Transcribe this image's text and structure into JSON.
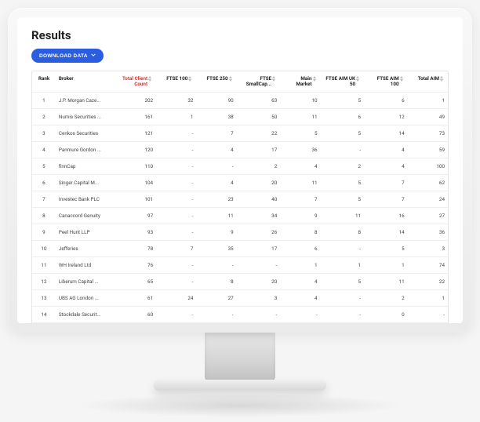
{
  "title": "Results",
  "download_label": "DOWNLOAD DATA",
  "columns": [
    {
      "label": "Rank",
      "sortable": false
    },
    {
      "label": "Broker",
      "sortable": false
    },
    {
      "label": "Total Client Count",
      "sortable": true,
      "sorted": true
    },
    {
      "label": "FTSE 100",
      "sortable": true
    },
    {
      "label": "FTSE 250",
      "sortable": true
    },
    {
      "label": "FTSE SmallCap...",
      "sortable": true
    },
    {
      "label": "Main Market",
      "sortable": true
    },
    {
      "label": "FTSE AIM UK 50",
      "sortable": true
    },
    {
      "label": "FTSE AIM 100",
      "sortable": true
    },
    {
      "label": "Total AIM",
      "sortable": true
    }
  ],
  "rows": [
    {
      "rank": 1,
      "broker": "J.P. Morgan Caze...",
      "cells": [
        "202",
        "32",
        "90",
        "63",
        "10",
        "5",
        "6",
        "1"
      ]
    },
    {
      "rank": 2,
      "broker": "Numis Securities ...",
      "cells": [
        "161",
        "1",
        "38",
        "50",
        "11",
        "6",
        "12",
        "49"
      ]
    },
    {
      "rank": 3,
      "broker": "Cenkos Securities",
      "cells": [
        "121",
        "-",
        "7",
        "22",
        "5",
        "5",
        "14",
        "73"
      ]
    },
    {
      "rank": 4,
      "broker": "Panmure Gordon ...",
      "cells": [
        "120",
        "-",
        "4",
        "17",
        "36",
        "-",
        "4",
        "59"
      ]
    },
    {
      "rank": 5,
      "broker": "finnCap",
      "cells": [
        "110",
        "-",
        "-",
        "2",
        "4",
        "2",
        "4",
        "100"
      ]
    },
    {
      "rank": 6,
      "broker": "Singer Capital M...",
      "cells": [
        "104",
        "-",
        "4",
        "20",
        "11",
        "5",
        "7",
        "62"
      ]
    },
    {
      "rank": 7,
      "broker": "Investec Bank PLC",
      "cells": [
        "101",
        "-",
        "23",
        "40",
        "7",
        "5",
        "7",
        "24"
      ]
    },
    {
      "rank": 8,
      "broker": "Canaccord Genuity",
      "cells": [
        "97",
        "-",
        "11",
        "34",
        "9",
        "11",
        "16",
        "27"
      ]
    },
    {
      "rank": 9,
      "broker": "Peel Hunt LLP",
      "cells": [
        "93",
        "-",
        "9",
        "26",
        "8",
        "8",
        "14",
        "36"
      ]
    },
    {
      "rank": 10,
      "broker": "Jefferies",
      "cells": [
        "78",
        "7",
        "35",
        "17",
        "6",
        "-",
        "5",
        "3"
      ]
    },
    {
      "rank": 11,
      "broker": "WH Ireland Ltd",
      "cells": [
        "76",
        "-",
        "-",
        "-",
        "1",
        "1",
        "1",
        "74"
      ]
    },
    {
      "rank": 12,
      "broker": "Liberum Capital ...",
      "cells": [
        "65",
        "-",
        "8",
        "20",
        "4",
        "5",
        "11",
        "22"
      ]
    },
    {
      "rank": 13,
      "broker": "UBS AG London ...",
      "cells": [
        "61",
        "24",
        "27",
        "3",
        "4",
        "-",
        "2",
        "1"
      ]
    },
    {
      "rank": 14,
      "broker": "Stockdale Securit...",
      "cells": [
        "60",
        "-",
        "-",
        "-",
        "-",
        "-",
        "0",
        "-"
      ]
    }
  ]
}
